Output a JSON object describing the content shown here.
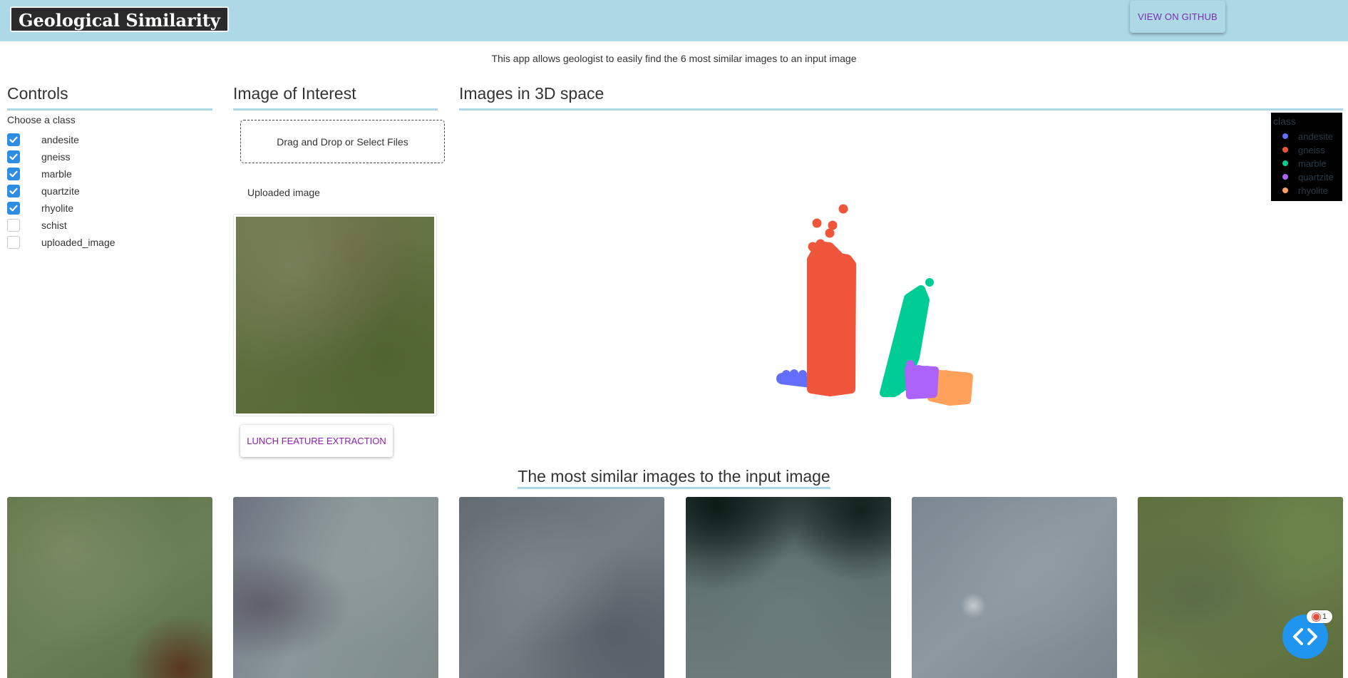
{
  "header": {
    "brand": "Geological Similarity",
    "github_button": "VIEW ON GITHUB",
    "background": "#add8e6"
  },
  "intro": "This app allows geologist to easily find the 6 most similar images to an input image",
  "controls": {
    "title": "Controls",
    "subtitle": "Choose a class",
    "classes": [
      {
        "label": "andesite",
        "checked": true
      },
      {
        "label": "gneiss",
        "checked": true
      },
      {
        "label": "marble",
        "checked": true
      },
      {
        "label": "quartzite",
        "checked": true
      },
      {
        "label": "rhyolite",
        "checked": true
      },
      {
        "label": "schist",
        "checked": false
      },
      {
        "label": "uploaded_image",
        "checked": false
      }
    ]
  },
  "image_of_interest": {
    "title": "Image of Interest",
    "dropzone_text": "Drag and Drop or Select Files",
    "uploaded_label": "Uploaded image",
    "launch_button": "LUNCH FEATURE EXTRACTION"
  },
  "plot": {
    "title": "Images in 3D space",
    "legend_title": "class",
    "legend": [
      {
        "name": "andesite",
        "color": "#636efa"
      },
      {
        "name": "gneiss",
        "color": "#ef553b"
      },
      {
        "name": "marble",
        "color": "#00cc96"
      },
      {
        "name": "quartzite",
        "color": "#ab63fa"
      },
      {
        "name": "rhyolite",
        "color": "#ffa15a"
      }
    ]
  },
  "similar": {
    "title": "The most similar images to the input image",
    "images": [
      "similar-image-1",
      "similar-image-2",
      "similar-image-3",
      "similar-image-4",
      "similar-image-5",
      "similar-image-6"
    ]
  },
  "dev_tools": {
    "icon": "code-brackets-icon",
    "badge_count": "1",
    "color": "#1f95f0"
  }
}
